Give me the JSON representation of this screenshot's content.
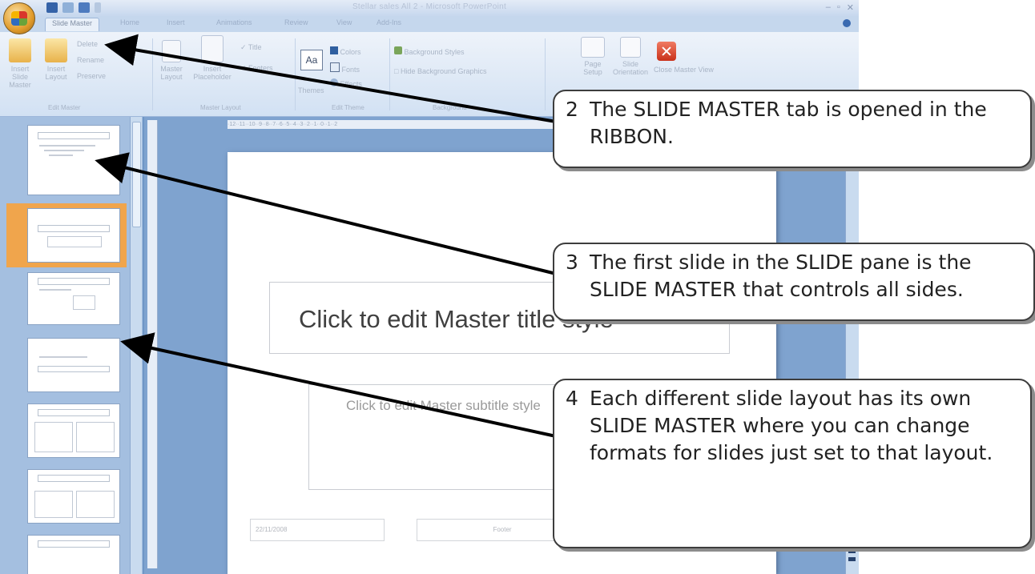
{
  "window": {
    "title": "Stellar sales All 2 - Microsoft PowerPoint"
  },
  "tabs": [
    "Slide Master",
    "Home",
    "Insert",
    "Animations",
    "Review",
    "View",
    "Add-Ins"
  ],
  "ribbon": {
    "insert_slide_master": "Insert Slide Master",
    "insert_layout": "Insert Layout",
    "delete": "Delete",
    "rename": "Rename",
    "preserve": "Preserve",
    "master_layout": "Master Layout",
    "insert_placeholder": "Insert Placeholder",
    "title_check": "Title",
    "footers_check": "Footers",
    "themes": "Themes",
    "colors": "Colors",
    "fonts": "Fonts",
    "effects": "Effects",
    "background_styles": "Background Styles",
    "hide_background": "Hide Background Graphics",
    "page_setup": "Page Setup",
    "slide_orientation": "Slide Orientation",
    "close_master": "Close Master View",
    "groups": {
      "edit_master": "Edit Master",
      "master_layout": "Master Layout",
      "edit_theme": "Edit Theme",
      "background": "Background"
    }
  },
  "ruler": {
    "marks": "·12··11··10··9··8··7··6··5··4··3··2··1··0··1··2"
  },
  "slide": {
    "title_placeholder": "Click to edit Master title style",
    "subtitle_placeholder": "Click to edit Master subtitle style",
    "footer_date": "22/11/2008",
    "footer_center": "Footer",
    "footer_number": "‹#›"
  },
  "callouts": [
    {
      "number": "2",
      "text": "The SLIDE MASTER tab is opened in the RIBBON."
    },
    {
      "number": "3",
      "text": "The first slide in the SLIDE pane is the SLIDE MASTER that controls all sides."
    },
    {
      "number": "4",
      "text": "Each different slide layout has its own SLIDE MASTER where you can change formats for slides just set to that layout."
    }
  ]
}
